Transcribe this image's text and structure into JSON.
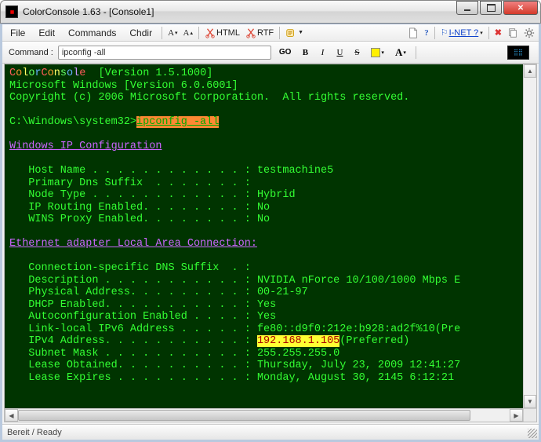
{
  "window": {
    "title": "ColorConsole 1.63  -  [Console1]"
  },
  "menu": {
    "file": "File",
    "edit": "Edit",
    "commands": "Commands",
    "chdir": "Chdir",
    "html_label": "HTML",
    "rtf_label": "RTF",
    "inet_label": "I-NET ?"
  },
  "commandbar": {
    "label": "Command :",
    "value": "ipconfig -all",
    "go_label": "GO"
  },
  "console": {
    "banner_version": "[Version 1.5.1000]",
    "ms_line": "Microsoft Windows [Version 6.0.6001]",
    "copyright": "Copyright (c) 2006 Microsoft Corporation.  All rights reserved.",
    "prompt_path": "C:\\Windows\\system32>",
    "prompt_cmd": "ipconfig -all",
    "section_ipcfg": "Windows IP Configuration",
    "host_name_label": "   Host Name . . . . . . . . . . . . : ",
    "host_name_value": "testmachine5",
    "primary_dns_label": "   Primary Dns Suffix  . . . . . . . :",
    "node_type_label": "   Node Type . . . . . . . . . . . . : ",
    "node_type_value": "Hybrid",
    "ip_routing_label": "   IP Routing Enabled. . . . . . . . : ",
    "ip_routing_value": "No",
    "wins_proxy_label": "   WINS Proxy Enabled. . . . . . . . : ",
    "wins_proxy_value": "No",
    "section_eth": "Ethernet adapter Local Area Connection:",
    "conn_dns_label": "   Connection-specific DNS Suffix  . :",
    "desc_label": "   Description . . . . . . . . . . . : ",
    "desc_value": "NVIDIA nForce 10/100/1000 Mbps E",
    "phys_label": "   Physical Address. . . . . . . . . : ",
    "phys_value": "00-21-97",
    "dhcp_label": "   DHCP Enabled. . . . . . . . . . . : ",
    "dhcp_value": "Yes",
    "autocfg_label": "   Autoconfiguration Enabled . . . . : ",
    "autocfg_value": "Yes",
    "ll_ipv6_label": "   Link-local IPv6 Address . . . . . : ",
    "ll_ipv6_value": "fe80::d9f0:212e:b928:ad2f%10(Pre",
    "ipv4_label": "   IPv4 Address. . . . . . . . . . . : ",
    "ipv4_value": "192.168.1.105",
    "ipv4_suffix": "(Preferred)",
    "subnet_label": "   Subnet Mask . . . . . . . . . . . : ",
    "subnet_value": "255.255.255.0",
    "lease_obt_label": "   Lease Obtained. . . . . . . . . . : ",
    "lease_obt_value": "Thursday, July 23, 2009 12:41:27",
    "lease_exp_label": "   Lease Expires . . . . . . . . . . : ",
    "lease_exp_value": "Monday, August 30, 2145 6:12:21"
  },
  "status": {
    "text": "Bereit / Ready"
  }
}
